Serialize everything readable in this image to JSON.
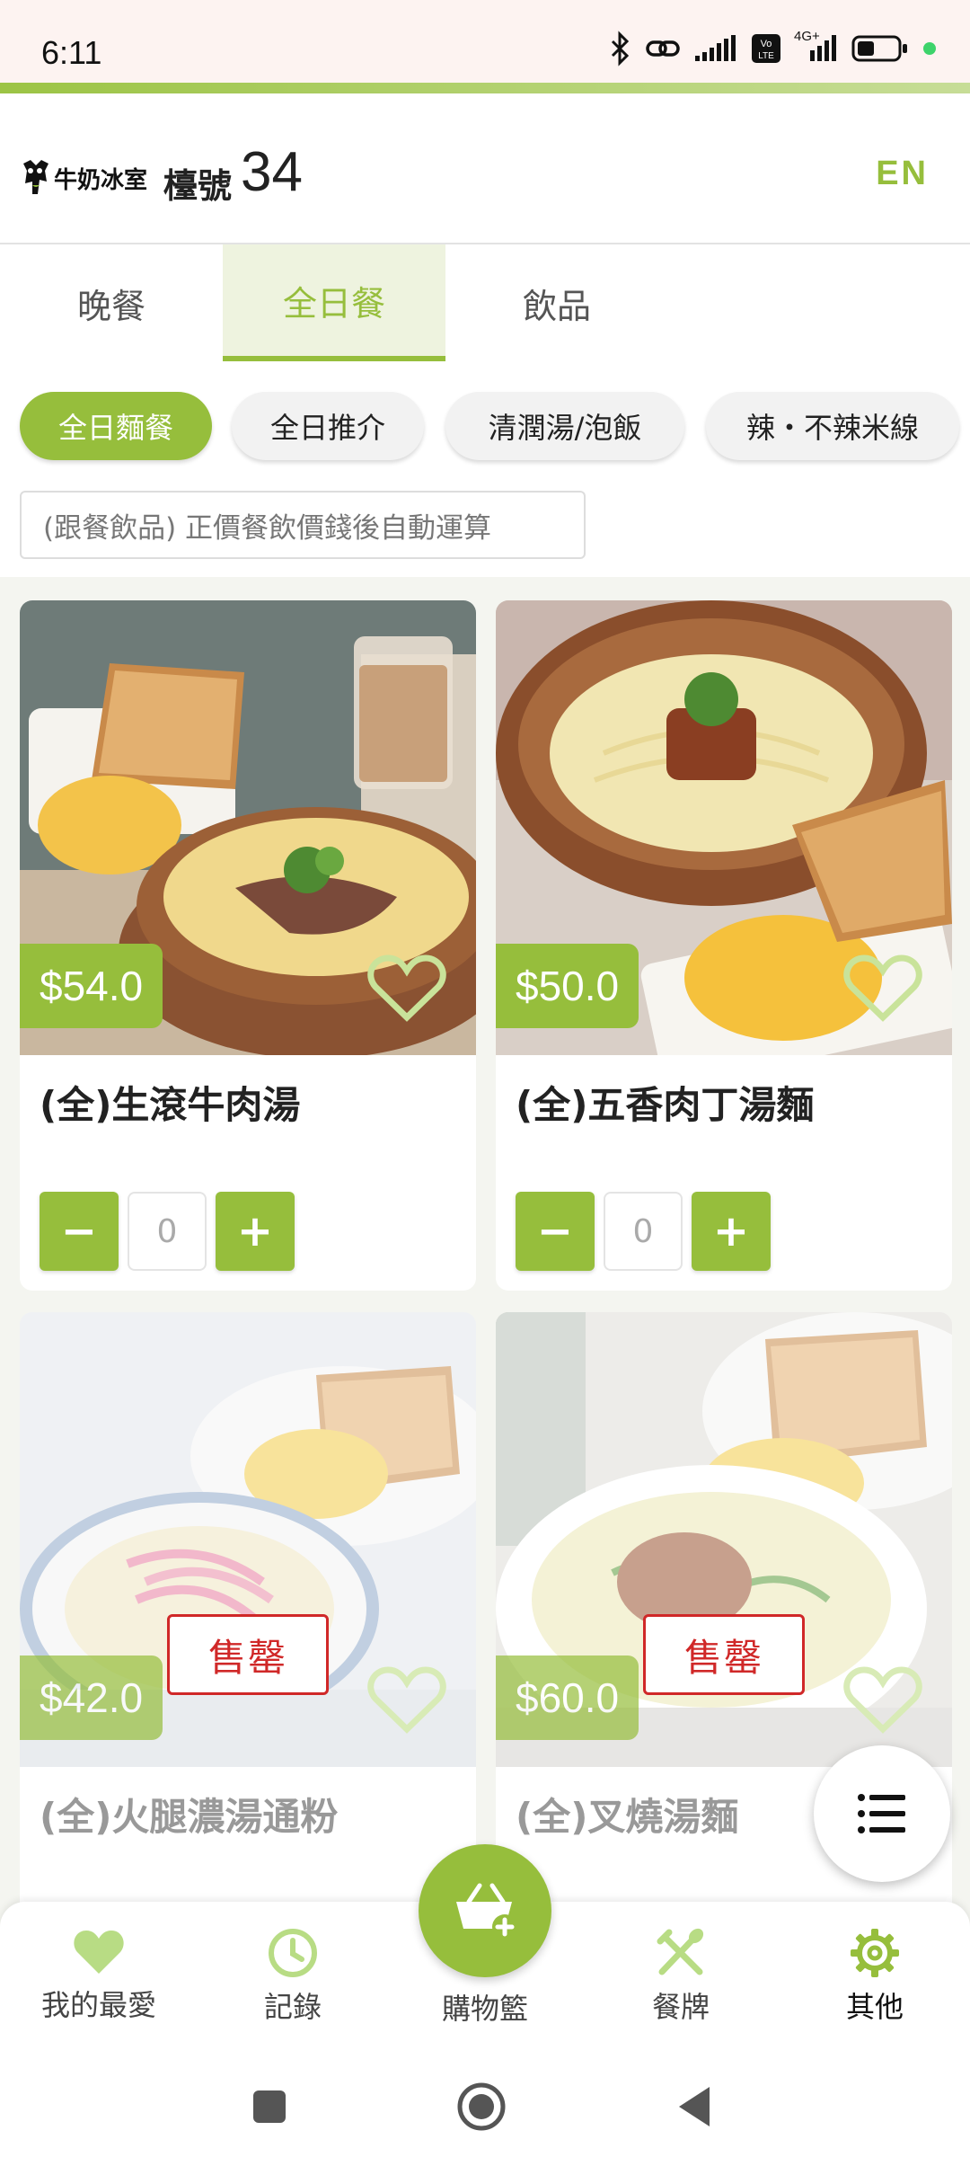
{
  "status_bar": {
    "time": "6:11",
    "network": "4G+"
  },
  "header": {
    "logo_text": "牛奶冰室",
    "table_label": "檯號",
    "table_number": "34",
    "lang_button": "EN"
  },
  "tabs": [
    {
      "label": "晚餐",
      "active": false
    },
    {
      "label": "全日餐",
      "active": true
    },
    {
      "label": "飲品",
      "active": false
    }
  ],
  "categories": [
    {
      "label": "全日麵餐",
      "active": true
    },
    {
      "label": "全日推介",
      "active": false
    },
    {
      "label": "清潤湯/泡飯",
      "active": false
    },
    {
      "label": "辣・不辣米線",
      "active": false
    }
  ],
  "note": "(跟餐飲品) 正價餐飲價錢後自動運算",
  "items": [
    {
      "name": "(全)生滾牛肉湯",
      "price": "$54.0",
      "qty": "0",
      "sold_out": false
    },
    {
      "name": "(全)五香肉丁湯麵",
      "price": "$50.0",
      "qty": "0",
      "sold_out": false
    },
    {
      "name": "(全)火腿濃湯通粉",
      "price": "$42.0",
      "sold_out": true,
      "sold_out_label": "售罄"
    },
    {
      "name": "(全)叉燒湯麵",
      "price": "$60.0",
      "sold_out": true,
      "sold_out_label": "售罄"
    }
  ],
  "stepper": {
    "minus": "−",
    "plus": "+"
  },
  "bottom_nav": {
    "favorites": "我的最愛",
    "history": "記錄",
    "cart": "購物籃",
    "menu": "餐牌",
    "others": "其他"
  },
  "colors": {
    "accent": "#96be3c",
    "sold_out": "#d02828"
  }
}
